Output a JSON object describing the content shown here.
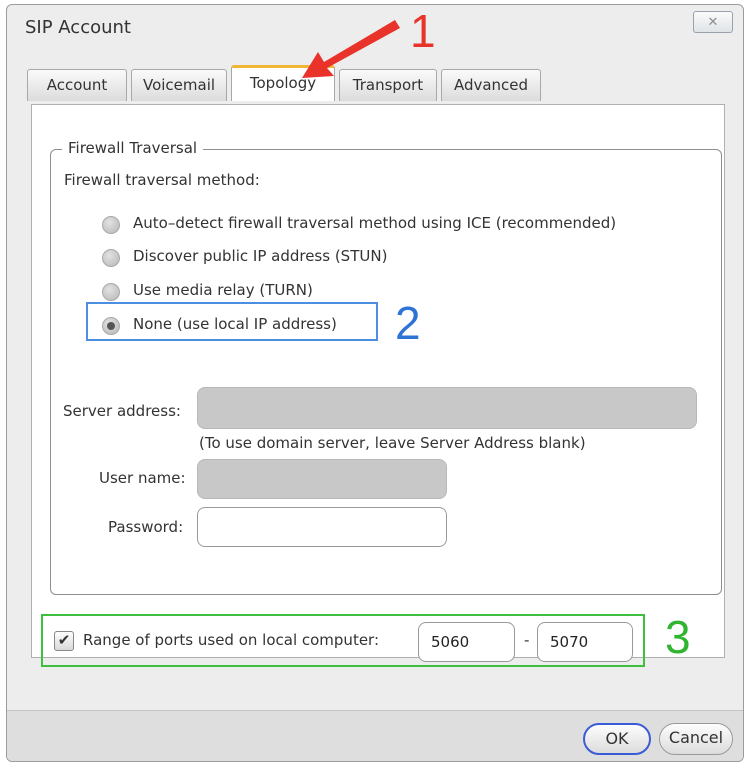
{
  "window": {
    "title": "SIP Account",
    "close_icon": "close-icon"
  },
  "tabs": [
    {
      "label": "Account"
    },
    {
      "label": "Voicemail"
    },
    {
      "label": "Topology",
      "active": true
    },
    {
      "label": "Transport"
    },
    {
      "label": "Advanced"
    }
  ],
  "firewall": {
    "legend": "Firewall Traversal",
    "method_label": "Firewall traversal method:",
    "options": [
      {
        "label": "Auto–detect firewall traversal method using ICE (recommended)",
        "selected": false
      },
      {
        "label": "Discover public IP address (STUN)",
        "selected": false
      },
      {
        "label": "Use media relay (TURN)",
        "selected": false
      },
      {
        "label": "None (use local IP address)",
        "selected": true
      }
    ],
    "server_address_label": "Server address:",
    "server_address_value": "",
    "server_hint": "(To use domain server, leave Server Address blank)",
    "username_label": "User name:",
    "username_value": "",
    "password_label": "Password:",
    "password_value": ""
  },
  "ports": {
    "checked": true,
    "label": "Range of ports used on local computer:",
    "from": "5060",
    "separator": "-",
    "to": "5070"
  },
  "buttons": {
    "ok": "OK",
    "cancel": "Cancel"
  },
  "annotations": {
    "one": "1",
    "two": "2",
    "three": "3"
  },
  "colors": {
    "annot_red": "#e8322a",
    "annot_blue": "#2f73d6",
    "annot_green": "#2fb52f",
    "tab_accent": "#f2b636",
    "ok_border": "#3b5bd6"
  }
}
